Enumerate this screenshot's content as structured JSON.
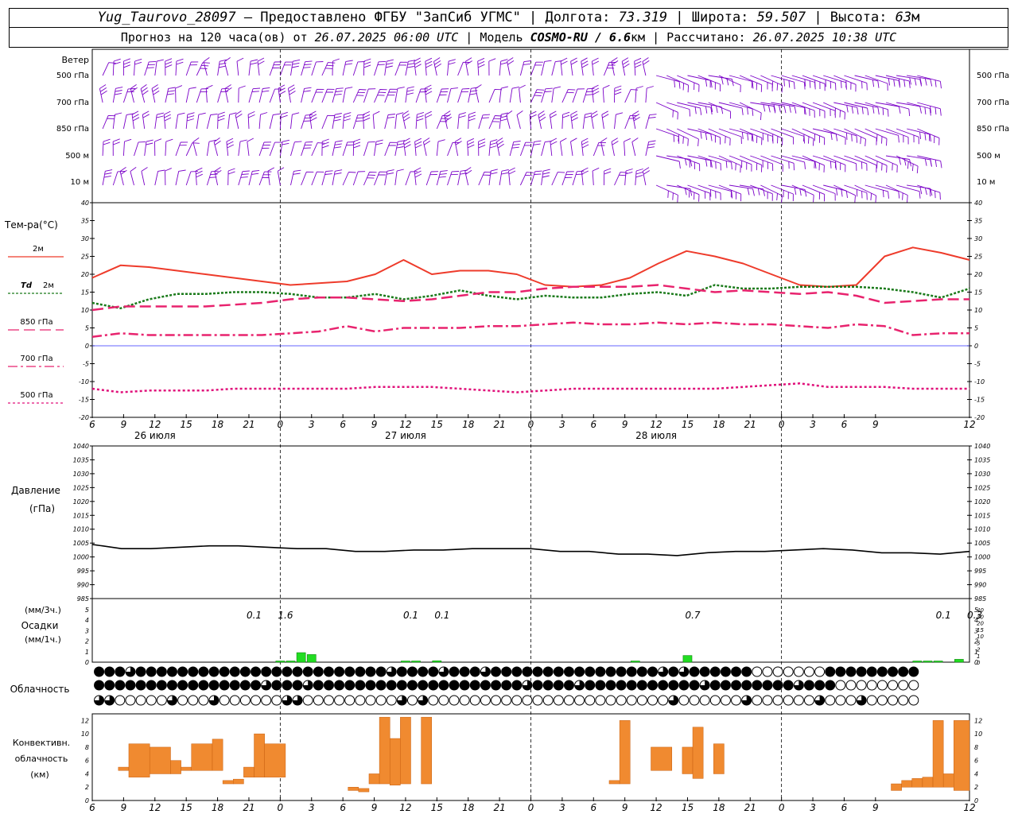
{
  "header": {
    "station": "Yug_Taurovo_28097",
    "dash": " – Предоставлено ФГБУ \"ЗапСиб УГМС\" | Долгота: ",
    "lon": "73.319",
    "lat_label": " | Широта: ",
    "lat": "59.507",
    "alt_label": " | Высота: ",
    "alt": "63",
    "alt_unit": "м",
    "forecast_prefix": "Прогноз на 120 часа(ов) от ",
    "forecast_time": "26.07.2025 06:00 UTC",
    "model_label": "  | Модель ",
    "model": "COSMO-RU / 6.6",
    "model_unit": "км",
    "calc_label": " | Рассчитано: ",
    "calc_time": "26.07.2025 10:38 UTC"
  },
  "labels": {
    "wind": "Ветер",
    "wind_levels": [
      "500 гПа",
      "700 гПа",
      "850 гПа",
      "500 м",
      "10  м"
    ],
    "temp": "Тем-ра(°C)",
    "legend_2m": "2м",
    "legend_td_a": "Td",
    "legend_td_b": "2м",
    "legend_850": "850 гПа",
    "legend_700": "700 гПа",
    "legend_500": "500 гПа",
    "pressure": "Давление",
    "pressure_unit": "(гПа)",
    "precip_unit_3h": "(мм/3ч.)",
    "precip": "Осадки",
    "precip_unit_1h": "(мм/1ч.)",
    "cloud": "Облачность",
    "conv1": "Конвективн.",
    "conv2": "облачность",
    "conv3": "(км)"
  },
  "colors": {
    "wind": "#7a00c8",
    "t2m": "#ee3b2b",
    "td2m": "#1a7a1a",
    "t850": "#e8236e",
    "t700": "#e8236e",
    "t500": "#e0107a",
    "zero": "#3030ff",
    "precip": "#22dd22",
    "conv": "#f08a30"
  },
  "time_axis": {
    "hour_labels": [
      "6",
      "9",
      "12",
      "15",
      "18",
      "21",
      "0",
      "3",
      "6",
      "9",
      "12",
      "15",
      "18",
      "21",
      "0",
      "3",
      "6",
      "9",
      "12",
      "15",
      "18",
      "21",
      "0",
      "3",
      "6",
      "9",
      "12"
    ],
    "day_labels": [
      "26 июля",
      "27 июля",
      "28 июля"
    ]
  },
  "chart_data": [
    {
      "type": "line",
      "title": "Тем-ра(°C)",
      "ylim": [
        -20,
        40
      ],
      "x_hours_from_start": [
        0,
        3,
        6,
        9,
        12,
        15,
        18,
        21,
        24,
        27,
        30,
        33,
        36,
        39,
        42,
        45,
        48,
        51,
        54,
        57,
        60,
        63,
        66,
        69,
        72,
        75,
        78
      ],
      "series": [
        {
          "name": "2м",
          "values": [
            19,
            22.5,
            22,
            21,
            20,
            19,
            18,
            17,
            17.5,
            18,
            20,
            24,
            20,
            21,
            21,
            20,
            17,
            16.5,
            17,
            19,
            23,
            26.5,
            25,
            23,
            20,
            17,
            16.5,
            17,
            25,
            27.5,
            26,
            24
          ]
        },
        {
          "name": "Td 2м",
          "values": [
            12,
            10.5,
            13,
            14.5,
            14.5,
            15,
            15,
            14.5,
            13.5,
            13.5,
            14.5,
            13,
            14,
            15.5,
            14,
            13,
            14,
            13.5,
            13.5,
            14.5,
            15,
            14,
            17,
            16,
            16,
            16.5,
            16.5,
            16.5,
            16,
            15,
            13.5,
            16
          ]
        },
        {
          "name": "850 гПа",
          "values": [
            10,
            11,
            11,
            11,
            11,
            11.5,
            12,
            13,
            13.5,
            13.5,
            13,
            12.5,
            13,
            14,
            15,
            15,
            16,
            16.5,
            16.5,
            16.5,
            17,
            16,
            15,
            15.5,
            15,
            14.5,
            15,
            14,
            12,
            12.5,
            13,
            13
          ]
        },
        {
          "name": "700 гПа",
          "values": [
            2.5,
            3.5,
            3,
            3,
            3,
            3,
            3,
            3.5,
            4,
            5.5,
            4,
            5,
            5,
            5,
            5.5,
            5.5,
            6,
            6.5,
            6,
            6,
            6.5,
            6,
            6.5,
            6,
            6,
            5.5,
            5,
            6,
            5.5,
            3,
            3.5,
            3.5
          ]
        },
        {
          "name": "500 гПа",
          "values": [
            -12,
            -13,
            -12.5,
            -12.5,
            -12.5,
            -12,
            -12,
            -12,
            -12,
            -12,
            -11.5,
            -11.5,
            -11.5,
            -12,
            -12.5,
            -13,
            -12.5,
            -12,
            -12,
            -12,
            -12,
            -12,
            -12,
            -11.5,
            -11,
            -10.5,
            -11.5,
            -11.5,
            -11.5,
            -12,
            -12,
            -12
          ]
        }
      ]
    },
    {
      "type": "line",
      "title": "Давление",
      "ylim": [
        985,
        1040
      ],
      "series": [
        {
          "name": "Давление",
          "values": [
            1004.5,
            1003,
            1003,
            1003.5,
            1004,
            1004,
            1003.5,
            1003,
            1003,
            1002,
            1002,
            1002.5,
            1002.5,
            1003,
            1003,
            1003,
            1002,
            1002,
            1001,
            1001,
            1000.5,
            1001.5,
            1002,
            1002,
            1002.5,
            1003,
            1002.5,
            1001.5,
            1001.5,
            1001,
            1002
          ]
        }
      ]
    },
    {
      "type": "bar",
      "title": "Осадки",
      "ylim": [
        0,
        5
      ],
      "labels_3h": [
        {
          "hour": 15.5,
          "text": "0.1"
        },
        {
          "hour": 18.5,
          "text": "1.6"
        },
        {
          "hour": 30.5,
          "text": "0.1"
        },
        {
          "hour": 33.5,
          "text": "0.1"
        },
        {
          "hour": 57.5,
          "text": "0.7"
        },
        {
          "hour": 81.5,
          "text": "0.1"
        },
        {
          "hour": 84.5,
          "text": "0.3"
        }
      ],
      "bars_1h": [
        {
          "hour": 18,
          "value": 0.1
        },
        {
          "hour": 19,
          "value": 0.1
        },
        {
          "hour": 20,
          "value": 1.0
        },
        {
          "hour": 21,
          "value": 0.8
        },
        {
          "hour": 30,
          "value": 0.05
        },
        {
          "hour": 31,
          "value": 0.05
        },
        {
          "hour": 33,
          "value": 0.15
        },
        {
          "hour": 52,
          "value": 0.05
        },
        {
          "hour": 57,
          "value": 0.7
        },
        {
          "hour": 79,
          "value": 0.1
        },
        {
          "hour": 80,
          "value": 0.1
        },
        {
          "hour": 81,
          "value": 0.1
        },
        {
          "hour": 83,
          "value": 0.3
        }
      ]
    },
    {
      "type": "bar",
      "title": "Конвективн. облачность (км)",
      "ylim": [
        0,
        13
      ],
      "ranges": [
        {
          "h0": 2.5,
          "h1": 3.5,
          "lo": 4.5,
          "hi": 5
        },
        {
          "h0": 3.5,
          "h1": 5.5,
          "lo": 3.5,
          "hi": 8.5
        },
        {
          "h0": 5.5,
          "h1": 7.5,
          "lo": 4,
          "hi": 8
        },
        {
          "h0": 7.5,
          "h1": 8.5,
          "lo": 4,
          "hi": 6
        },
        {
          "h0": 8.5,
          "h1": 9.5,
          "lo": 4.5,
          "hi": 5
        },
        {
          "h0": 9.5,
          "h1": 11.5,
          "lo": 4.5,
          "hi": 8.5
        },
        {
          "h0": 11.5,
          "h1": 12.5,
          "lo": 4.5,
          "hi": 9.2
        },
        {
          "h0": 12.5,
          "h1": 13.5,
          "lo": 2.5,
          "hi": 3
        },
        {
          "h0": 13.5,
          "h1": 14.5,
          "lo": 2.5,
          "hi": 3.2
        },
        {
          "h0": 14.5,
          "h1": 15.5,
          "lo": 3.5,
          "hi": 5
        },
        {
          "h0": 15.5,
          "h1": 16.5,
          "lo": 3.5,
          "hi": 10
        },
        {
          "h0": 16.5,
          "h1": 18.5,
          "lo": 3.5,
          "hi": 8.5
        },
        {
          "h0": 24.5,
          "h1": 25.5,
          "lo": 1.5,
          "hi": 2
        },
        {
          "h0": 25.5,
          "h1": 26.5,
          "lo": 1.3,
          "hi": 1.8
        },
        {
          "h0": 26.5,
          "h1": 27.5,
          "lo": 2.5,
          "hi": 4
        },
        {
          "h0": 27.5,
          "h1": 28.5,
          "lo": 2.5,
          "hi": 12.5
        },
        {
          "h0": 28.5,
          "h1": 29.5,
          "lo": 2.3,
          "hi": 9.3
        },
        {
          "h0": 29.5,
          "h1": 30.5,
          "lo": 2.5,
          "hi": 12.5
        },
        {
          "h0": 31.5,
          "h1": 32.5,
          "lo": 2.5,
          "hi": 12.5
        },
        {
          "h0": 49.5,
          "h1": 50.5,
          "lo": 2.5,
          "hi": 3
        },
        {
          "h0": 50.5,
          "h1": 51.5,
          "lo": 2.5,
          "hi": 12
        },
        {
          "h0": 53.5,
          "h1": 55.5,
          "lo": 4.5,
          "hi": 8
        },
        {
          "h0": 56.5,
          "h1": 57.5,
          "lo": 4,
          "hi": 8
        },
        {
          "h0": 57.5,
          "h1": 58.5,
          "lo": 3.3,
          "hi": 11
        },
        {
          "h0": 59.5,
          "h1": 60.5,
          "lo": 4,
          "hi": 8.5
        },
        {
          "h0": 76.5,
          "h1": 77.5,
          "lo": 1.5,
          "hi": 2.5
        },
        {
          "h0": 77.5,
          "h1": 78.5,
          "lo": 2,
          "hi": 3
        },
        {
          "h0": 78.5,
          "h1": 79.5,
          "lo": 2,
          "hi": 3.3
        },
        {
          "h0": 79.5,
          "h1": 80.5,
          "lo": 2,
          "hi": 3.5
        },
        {
          "h0": 80.5,
          "h1": 81.5,
          "lo": 2,
          "hi": 12
        },
        {
          "h0": 81.5,
          "h1": 82.5,
          "lo": 2,
          "hi": 4
        },
        {
          "h0": 82.5,
          "h1": 84,
          "lo": 1.5,
          "hi": 12
        }
      ]
    }
  ]
}
